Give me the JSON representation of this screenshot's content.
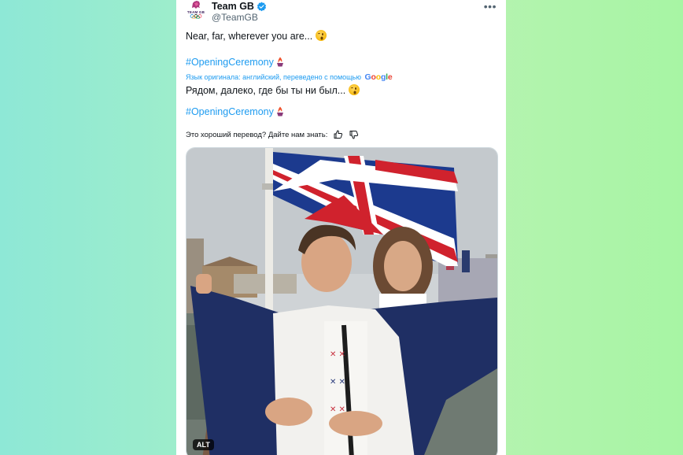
{
  "account": {
    "name": "Team GB",
    "handle": "@TeamGB",
    "avatar_text": "TEAM GB",
    "verified": true
  },
  "tweet": {
    "original_text": "Near, far, wherever you are...",
    "hashtag": "#OpeningCeremony",
    "translation_note": "Язык оригинала: английский, переведено с помощью",
    "translation_provider": "Google",
    "translated_text": "Рядом, далеко, где бы ты ни был...",
    "translated_hashtag": "#OpeningCeremony"
  },
  "feedback": {
    "prompt": "Это хороший перевод? Дайте нам знать:"
  },
  "media": {
    "alt_badge": "ALT"
  },
  "icons": {
    "more": "more-options-icon",
    "verified": "verified-badge-icon",
    "thumb_up": "thumb-up-icon",
    "thumb_down": "thumb-down-icon",
    "emoji": "winking-face-emoji",
    "hashtag_emoji": "olympic-flame-icon"
  },
  "colors": {
    "link": "#1d9bf0",
    "text": "#0f1419",
    "secondary": "#536471",
    "background_left": "#8ee8d6",
    "background_right": "#a7f5a4"
  }
}
